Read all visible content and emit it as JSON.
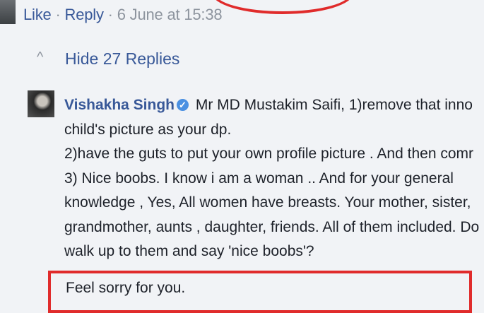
{
  "actions": {
    "like": "Like",
    "sep1": " · ",
    "reply": "Reply",
    "sep2": " · ",
    "timestamp": "6 June at 15:38"
  },
  "replies": {
    "caret": "^",
    "label": "Hide 27 Replies"
  },
  "comment": {
    "author": "Vishakha Singh",
    "lines": [
      " Mr MD Mustakim Saifi, 1)remove that inno",
      "child's picture as your dp.",
      "2)have the guts to put your own profile picture . And then comr",
      "3) Nice boobs. I know i am a woman .. And for your general",
      "knowledge , Yes, All women have breasts. Your mother, sister,",
      "grandmother, aunts , daughter, friends. All of them included. Do",
      "walk up to them and say 'nice boobs'?",
      "Feel sorry for you."
    ]
  },
  "colors": {
    "link": "#385898",
    "highlight": "#e02b2b",
    "meta": "#8d949e"
  },
  "icons": {
    "verified": "verified-badge-icon",
    "caret": "caret-up-icon"
  }
}
